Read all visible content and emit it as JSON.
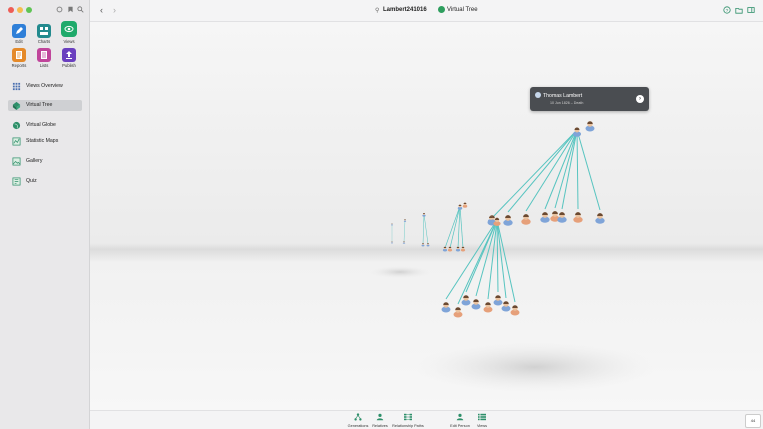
{
  "app": {
    "document_title": "Lambert241016",
    "current_view": "Virtual Tree"
  },
  "toolbar": {
    "tiles": [
      {
        "label": "Edit",
        "color": "#2f7fd8",
        "icon": "pencil-icon"
      },
      {
        "label": "Charts",
        "color": "#238a8e",
        "icon": "chart-icon"
      },
      {
        "label": "Views",
        "color": "#1faa6b",
        "icon": "eye-icon"
      },
      {
        "label": "Reports",
        "color": "#e58a2a",
        "icon": "report-icon"
      },
      {
        "label": "Lists",
        "color": "#c0459b",
        "icon": "list-icon"
      },
      {
        "label": "Publish",
        "color": "#6a3fbf",
        "icon": "publish-icon"
      }
    ]
  },
  "sidebar": {
    "items": [
      {
        "label": "Views Overview",
        "icon": "grid-icon"
      },
      {
        "label": "Virtual Tree",
        "icon": "tree-icon",
        "selected": true
      },
      {
        "label": "Virtual Globe",
        "icon": "globe-icon"
      },
      {
        "label": "Statistic Maps",
        "icon": "map-icon"
      },
      {
        "label": "Gallery",
        "icon": "gallery-icon"
      },
      {
        "label": "Quiz",
        "icon": "quiz-icon"
      }
    ]
  },
  "popup": {
    "name": "Thomas Lambert",
    "detail": "10 Jun 1826 – Death"
  },
  "bottom": {
    "items": [
      {
        "label": "Generations",
        "icon": "generations-icon"
      },
      {
        "label": "Relatives",
        "icon": "relatives-icon"
      },
      {
        "label": "Relationship Paths",
        "icon": "relationship-paths-icon"
      },
      {
        "label": "Edit Person",
        "icon": "edit-person-icon"
      },
      {
        "label": "Views",
        "icon": "views-icon"
      }
    ]
  },
  "zoom_control": "44",
  "colors": {
    "accent": "#1faa6b",
    "tree_line": "#57c4c0",
    "male": "#7fa4d8",
    "female": "#e6a07a"
  }
}
